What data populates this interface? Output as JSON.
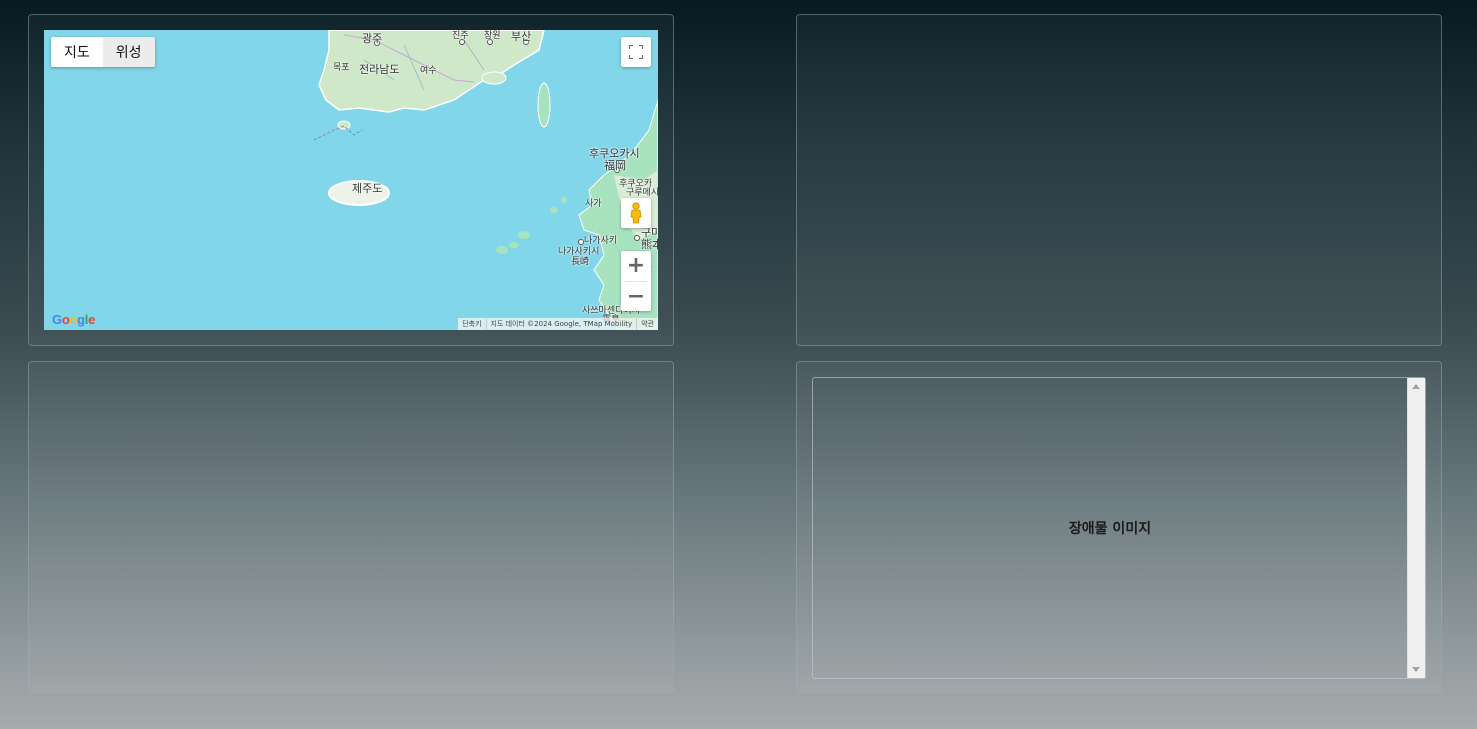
{
  "map": {
    "type_buttons": {
      "map": "지도",
      "satellite": "위성"
    },
    "places": {
      "gwangju": "광주",
      "jinju": "진주",
      "changwon": "창원",
      "busan": "부산",
      "mokpo": "목포",
      "jeollanamdo": "전라남도",
      "yeosu": "여수",
      "fukuoka_ko": "후쿠오카시",
      "fukuoka_ja": "福岡",
      "jeju": "제주도",
      "kurume": "구루메시",
      "fukuoka_small": "후쿠오카",
      "saga": "사가",
      "nagasaki_small": "나가사키",
      "nagasaki_ko": "나가사키시",
      "nagasaki_ja": "長崎",
      "kumamoto_ko": "구마",
      "kumamoto_ja": "熊本",
      "satsumasendai": "사쓰마센다이시",
      "kirishima": "霧島"
    },
    "logo": "Google",
    "attribution": {
      "shortcuts": "단축키",
      "data": "지도 데이터 ©2024 Google, TMap Mobility",
      "terms": "약관"
    },
    "icons": {
      "fullscreen": "fullscreen-icon",
      "pegman": "pegman-icon",
      "zoom_in": "zoom-in-icon",
      "zoom_out": "zoom-out-icon"
    },
    "zoom_in_symbol": "+",
    "zoom_out_symbol": "−"
  },
  "image_panel": {
    "label": "장애물 이미지"
  }
}
